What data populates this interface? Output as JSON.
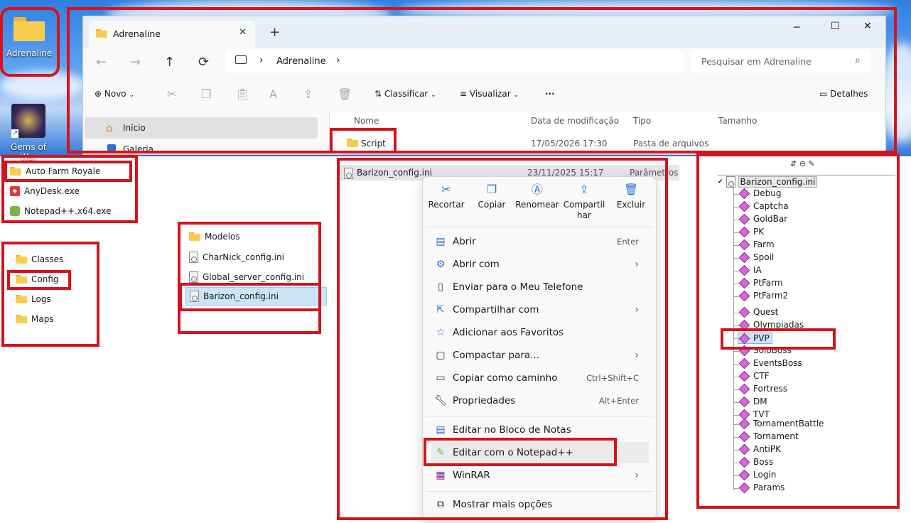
{
  "desktop": {
    "icons": [
      {
        "label": "Adrenaline",
        "icon": "folder-icon"
      },
      {
        "label": "Gems of War",
        "icon": "game-shortcut-icon"
      }
    ]
  },
  "explorer": {
    "tab_title": "Adrenaline",
    "new_tab": "+",
    "window_controls": {
      "minimize": "─",
      "maximize": "☐",
      "close": "✕"
    },
    "nav": {
      "back": "←",
      "forward": "→",
      "up": "↑",
      "refresh": "⟳"
    },
    "address": {
      "separator": "›",
      "segment": "Adrenaline"
    },
    "search": {
      "placeholder": "Pesquisar em Adrenaline"
    },
    "toolbar": {
      "new": "Novo",
      "sort": "Classificar",
      "view": "Visualizar",
      "more": "···",
      "details": "Detalhes"
    },
    "sidebar": [
      {
        "label": "Início",
        "icon": "home-icon"
      },
      {
        "label": "Galeria",
        "icon": "gallery-icon"
      }
    ],
    "columns": [
      "Nome",
      "Data de modificação",
      "Tipo",
      "Tamanho"
    ],
    "rows": [
      {
        "name": "Script",
        "date": "17/05/2026 17:30",
        "type": "Pasta de arquivos",
        "size": ""
      }
    ]
  },
  "selected_file_row": {
    "name": "Barizon_config.ini",
    "date": "23/11/2025 15:17",
    "type": "Parâmetros d"
  },
  "panel_apps": {
    "items": [
      "Auto Farm Royale",
      "AnyDesk.exe",
      "Notepad++.x64.exe"
    ]
  },
  "panel_folders": {
    "items": [
      "Classes",
      "Config",
      "Logs",
      "Maps"
    ]
  },
  "panel_config": {
    "items": [
      "Modelos",
      "CharNick_config.ini",
      "Global_server_config.ini",
      "Barizon_config.ini"
    ]
  },
  "context_menu": {
    "quick_actions": [
      {
        "label": "Recortar",
        "icon": "scissors-icon"
      },
      {
        "label": "Copiar",
        "icon": "copy-icon"
      },
      {
        "label": "Renomear",
        "icon": "rename-icon"
      },
      {
        "label": "Compartil har",
        "line1": "Compartil",
        "line2": "har",
        "icon": "share-icon"
      },
      {
        "label": "Excluir",
        "icon": "trash-icon"
      }
    ],
    "items": [
      {
        "label": "Abrir",
        "shortcut": "Enter",
        "icon": "open-icon"
      },
      {
        "label": "Abrir com",
        "icon": "open-with-icon",
        "submenu": "›"
      },
      {
        "label": "Enviar para o Meu Telefone",
        "icon": "phone-icon"
      },
      {
        "label": "Compartilhar com",
        "icon": "share-with-icon",
        "submenu": "›"
      },
      {
        "label": "Adicionar aos Favoritos",
        "icon": "star-icon"
      },
      {
        "label": "Compactar para...",
        "icon": "zip-icon",
        "submenu": "›"
      },
      {
        "label": "Copiar como caminho",
        "shortcut": "Ctrl+Shift+C",
        "icon": "path-icon"
      },
      {
        "label": "Propriedades",
        "shortcut": "Alt+Enter",
        "icon": "wrench-icon"
      },
      {
        "label": "Editar no Bloco de Notas",
        "icon": "notepad-icon"
      },
      {
        "label": "Editar com o Notepad++",
        "icon": "notepadpp-icon"
      },
      {
        "label": "WinRAR",
        "icon": "winrar-icon",
        "submenu": "›"
      },
      {
        "label": "Mostrar mais opções",
        "icon": "more-options-icon"
      }
    ]
  },
  "tree": {
    "toolbar": "⇵ ⊖ ✎",
    "root": "Barizon_config.ini",
    "nodes": [
      "Debug",
      "Captcha",
      "GoldBar",
      "PK",
      "Farm",
      "Spoil",
      "IA",
      "PtFarm",
      "PtFarm2",
      "Quest",
      "Olympiadas",
      "PVP",
      "SoloBoss",
      "EventsBoss",
      "CTF",
      "Fortress",
      "DM",
      "TVT",
      "TornamentBattle",
      "Tornament",
      "AntiPK",
      "Boss",
      "Login",
      "Params"
    ],
    "selected": "PVP"
  },
  "colors": {
    "highlight_red": "#d8121b",
    "accent_blue": "#2d6fd2",
    "selection": "#cce4f7"
  }
}
